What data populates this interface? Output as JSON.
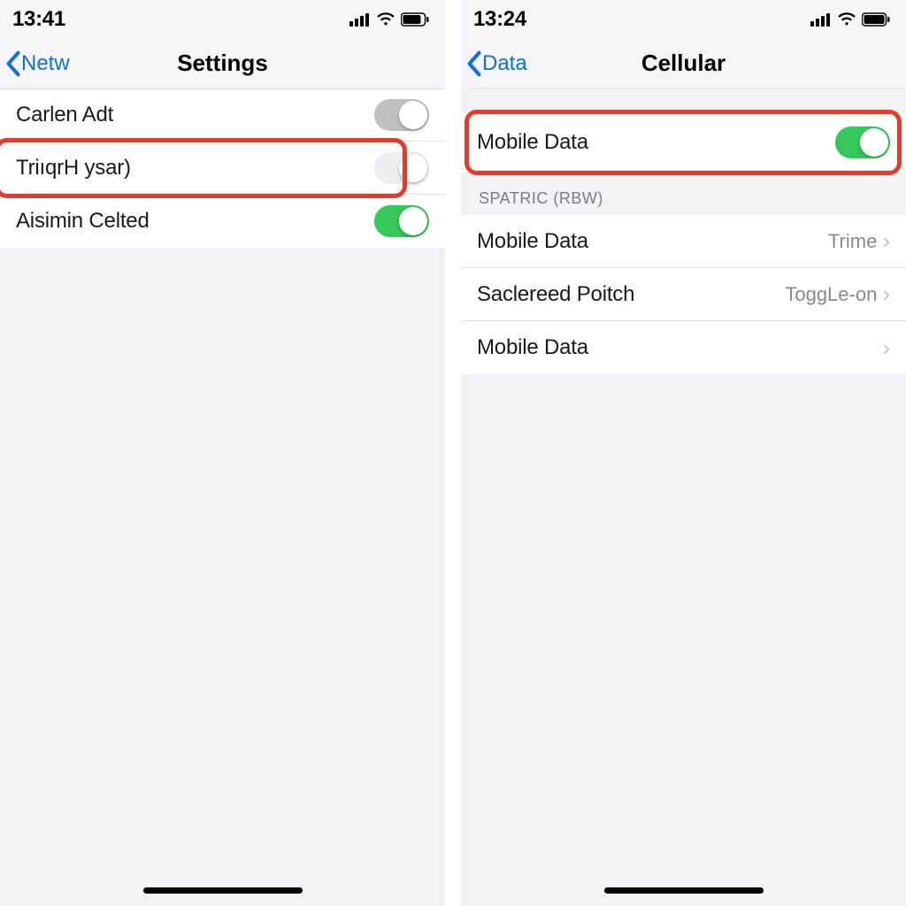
{
  "left": {
    "status_time": "13:41",
    "back_label": "Netw",
    "title": "Settings",
    "rows": [
      {
        "label": "Carlen Adt",
        "toggle": "off-gray"
      },
      {
        "label": "TriıqrH ysar)",
        "toggle": "off-light"
      },
      {
        "label": "Aisimin Celted",
        "toggle": "on"
      }
    ]
  },
  "right": {
    "status_time": "13:24",
    "back_label": "Data",
    "title": "Cellular",
    "toggle_row": {
      "label": "Mobile Data",
      "toggle": "on"
    },
    "section_header": "SPATRIC (RBW)",
    "detail_rows": [
      {
        "label": "Mobile Data",
        "detail": "Trime"
      },
      {
        "label": "Saclereed Poitch",
        "detail": "ToggLe-on"
      },
      {
        "label": "Mobile Data",
        "detail": ""
      }
    ]
  }
}
